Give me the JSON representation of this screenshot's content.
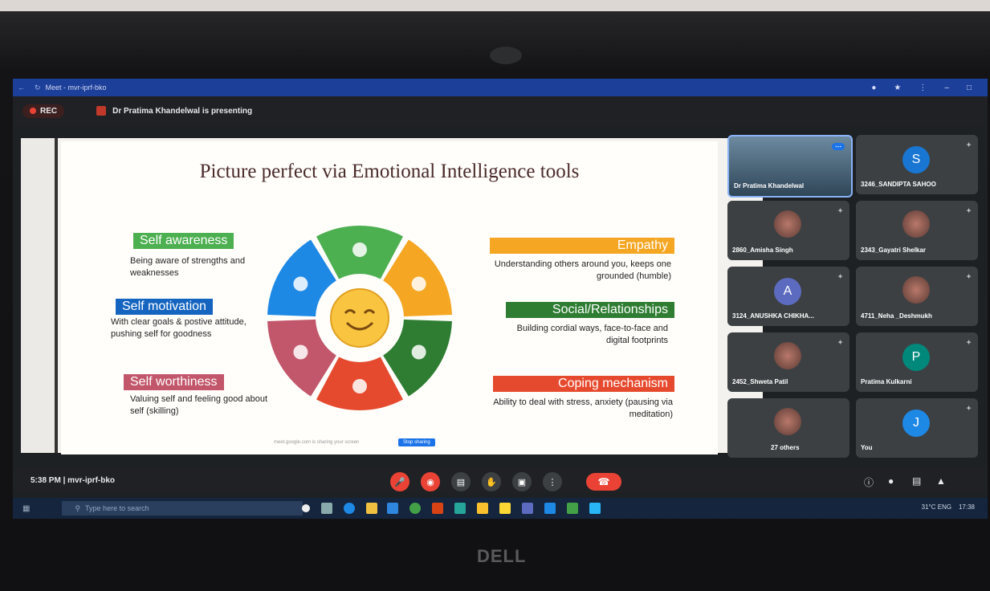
{
  "browser": {
    "tab_title": "Meet - mvr-iprf-bko"
  },
  "meeting": {
    "rec_label": "REC",
    "presenting": "Dr Pratima Khandelwal is presenting",
    "time_code": "5:38 PM | mvr-iprf-bko"
  },
  "slide": {
    "title": "Picture perfect via Emotional Intelligence tools",
    "left": [
      {
        "label": "Self awareness",
        "desc": "Being aware of strengths and weaknesses",
        "color": "#4caf50"
      },
      {
        "label": "Self motivation",
        "desc": "With clear goals & postive attitude, pushing self for goodness",
        "color": "#1565c0"
      },
      {
        "label": "Self worthiness",
        "desc": "Valuing self and feeling good about self (skilling)",
        "color": "#c2566a"
      }
    ],
    "right": [
      {
        "label": "Empathy",
        "desc": "Understanding others around you, keeps one grounded (humble)",
        "color": "#f5a623"
      },
      {
        "label": "Social/Relationships",
        "desc": "Building cordial ways, face-to-face and digital footprints",
        "color": "#2e7d32"
      },
      {
        "label": "Coping mechanism",
        "desc": "Ability to deal with stress, anxiety (pausing via meditation)",
        "color": "#e64a2e"
      }
    ],
    "wheel_colors": [
      "#4caf50",
      "#f5a623",
      "#2e7d32",
      "#e64a2e",
      "#c2566a",
      "#1e88e5"
    ],
    "share_button": "Stop sharing"
  },
  "participants": [
    {
      "name": "Dr Pratima Khandelwal",
      "kind": "video"
    },
    {
      "name": "3246_SANDIPTA SAHOO",
      "initial": "S",
      "color": "#1976d2"
    },
    {
      "name": "2860_Amisha Singh",
      "kind": "photo"
    },
    {
      "name": "2343_Gayatri Shelkar",
      "kind": "photo"
    },
    {
      "name": "3124_ANUSHKA CHIKHA...",
      "initial": "A",
      "color": "#5c6bc0"
    },
    {
      "name": "4711_Neha _Deshmukh",
      "kind": "photo"
    },
    {
      "name": "2452_Shweta Patil",
      "kind": "photo"
    },
    {
      "name": "Pratima Kulkarni",
      "initial": "P",
      "color": "#00897b"
    },
    {
      "name": "27 others",
      "kind": "group"
    },
    {
      "name": "You",
      "initial": "J",
      "color": "#1e88e5"
    }
  ],
  "taskbar": {
    "search_placeholder": "Type here to search",
    "tray_text": "31°C  ENG",
    "clock": "17:38"
  },
  "brand": "DELL"
}
